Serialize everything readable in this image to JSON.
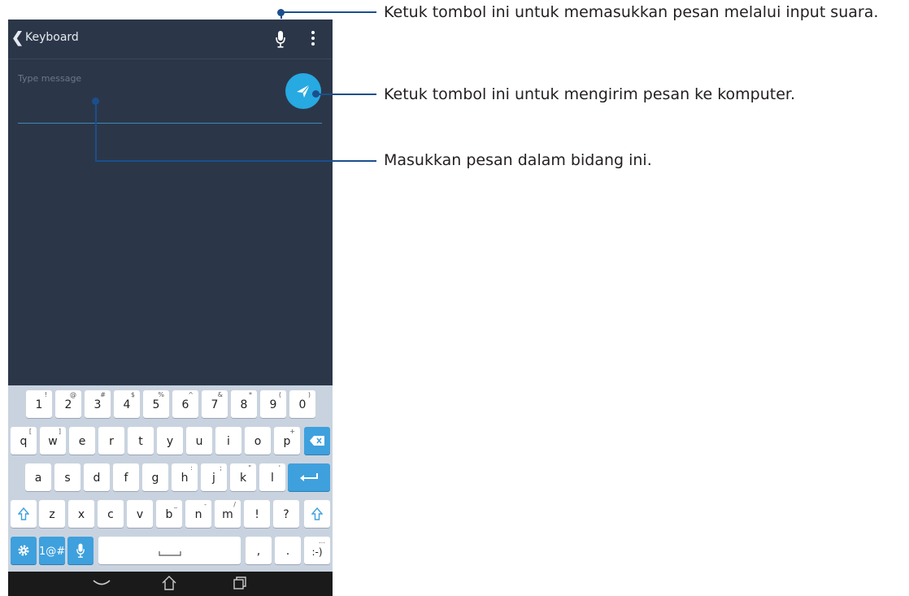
{
  "app": {
    "back_glyph": "❮",
    "title": "Keyboard",
    "mic_icon": "microphone-icon",
    "menu_icon": "more-vert-icon",
    "placeholder": "Type message",
    "send_icon": "send-icon"
  },
  "keyboard": {
    "row1": [
      {
        "main": "1",
        "sub": "!"
      },
      {
        "main": "2",
        "sub": "@"
      },
      {
        "main": "3",
        "sub": "#"
      },
      {
        "main": "4",
        "sub": "$"
      },
      {
        "main": "5",
        "sub": "%"
      },
      {
        "main": "6",
        "sub": "^"
      },
      {
        "main": "7",
        "sub": "&"
      },
      {
        "main": "8",
        "sub": "*"
      },
      {
        "main": "9",
        "sub": "("
      },
      {
        "main": "0",
        "sub": ")"
      }
    ],
    "row2": [
      {
        "main": "q",
        "sub": "["
      },
      {
        "main": "w",
        "sub": "]"
      },
      {
        "main": "e",
        "sub": ""
      },
      {
        "main": "r",
        "sub": ""
      },
      {
        "main": "t",
        "sub": ""
      },
      {
        "main": "y",
        "sub": ""
      },
      {
        "main": "u",
        "sub": ""
      },
      {
        "main": "i",
        "sub": ""
      },
      {
        "main": "o",
        "sub": ""
      },
      {
        "main": "p",
        "sub": "+"
      }
    ],
    "row3": [
      {
        "main": "a",
        "sub": ""
      },
      {
        "main": "s",
        "sub": ""
      },
      {
        "main": "d",
        "sub": ""
      },
      {
        "main": "f",
        "sub": ""
      },
      {
        "main": "g",
        "sub": ""
      },
      {
        "main": "h",
        "sub": ":"
      },
      {
        "main": "j",
        "sub": ";"
      },
      {
        "main": "k",
        "sub": "\""
      },
      {
        "main": "l",
        "sub": "'"
      }
    ],
    "row4": [
      {
        "main": "z",
        "sub": ""
      },
      {
        "main": "x",
        "sub": ""
      },
      {
        "main": "c",
        "sub": ""
      },
      {
        "main": "v",
        "sub": ""
      },
      {
        "main": "b",
        "sub": "_"
      },
      {
        "main": "n",
        "sub": "-"
      },
      {
        "main": "m",
        "sub": "/"
      },
      {
        "main": "!",
        "sub": ""
      },
      {
        "main": "?",
        "sub": ""
      }
    ],
    "symbols_label": "1@#",
    "comma": ",",
    "period": ".",
    "emoticon": ":-)",
    "emoticon_sub": "…"
  },
  "callouts": {
    "mic": "Ketuk tombol ini untuk memasukkan pesan melalui input suara.",
    "send": "Ketuk tombol ini untuk mengirim pesan ke komputer.",
    "field": "Masukkan pesan dalam bidang ini."
  },
  "colors": {
    "screen_bg": "#2b3749",
    "accent": "#27a9e1",
    "callout_line": "#1b4f8c",
    "keyboard_bg": "#c9d3df"
  }
}
